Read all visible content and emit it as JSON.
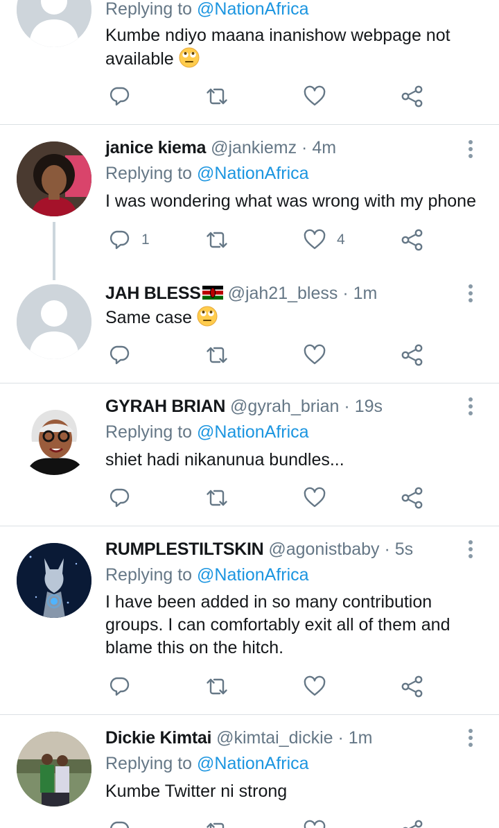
{
  "tweets": [
    {
      "name": "",
      "handle": "",
      "time": "",
      "replying_prefix": "Replying to ",
      "replying_to": "@NationAfrica",
      "text": "Kumbe ndiyo maana inanishow webpage not available",
      "reply_count": "",
      "like_count": ""
    },
    {
      "name": "janice kiema",
      "handle": "@jankiemz",
      "time": "4m",
      "replying_prefix": "Replying to ",
      "replying_to": "@NationAfrica",
      "text": "I was wondering what was wrong with my phone",
      "reply_count": "1",
      "like_count": "4"
    },
    {
      "name": "JAH BLESS",
      "handle": "@jah21_bless",
      "time": "1m",
      "text": "Same case"
    },
    {
      "name": "GYRAH BRIAN",
      "handle": "@gyrah_brian",
      "time": "19s",
      "replying_prefix": "Replying to ",
      "replying_to": "@NationAfrica",
      "text": "shiet hadi nikanunua bundles..."
    },
    {
      "name": "RUMPLESTILTSKIN",
      "handle": "@agonistbaby",
      "time": "5s",
      "replying_prefix": "Replying to ",
      "replying_to": "@NationAfrica",
      "text_lines": [
        "I have been added in so many contribution",
        "groups. I can comfortably exit all of them and",
        "blame this on the hitch."
      ]
    },
    {
      "name": "Dickie Kimtai",
      "handle": "@kimtai_dickie",
      "time": "1m",
      "replying_prefix": "Replying to ",
      "replying_to": "@NationAfrica",
      "text": "Kumbe Twitter ni strong"
    }
  ],
  "separator": "·",
  "icons": {
    "reply": "reply-icon",
    "retweet": "retweet-icon",
    "like": "heart-icon",
    "share": "share-icon",
    "more": "more-vertical-icon",
    "emoji": "face-with-rolling-eyes-emoji",
    "flag": "kenya-flag-emoji"
  },
  "colors": {
    "link": "#1b95e0",
    "secondary_text": "#657786",
    "primary_text": "#14171a",
    "divider": "#dbe0e4",
    "icon": "#657786"
  }
}
